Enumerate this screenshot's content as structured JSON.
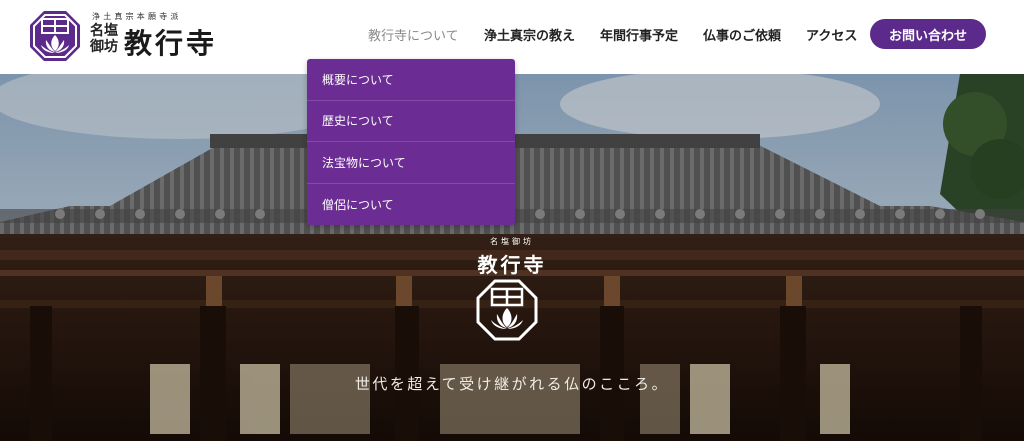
{
  "logo": {
    "sub_text": "浄土真宗本願寺派",
    "small_text": "名塩御坊",
    "main_text": "教行寺"
  },
  "nav": {
    "items": [
      {
        "label": "教行寺について"
      },
      {
        "label": "浄土真宗の教え"
      },
      {
        "label": "年間行事予定"
      },
      {
        "label": "仏事のご依頼"
      },
      {
        "label": "アクセス"
      }
    ],
    "contact_label": "お問い合わせ"
  },
  "dropdown": {
    "items": [
      {
        "label": "概要について"
      },
      {
        "label": "歴史について"
      },
      {
        "label": "法宝物について"
      },
      {
        "label": "僧侶について"
      }
    ]
  },
  "hero": {
    "small_text": "名塩御坊",
    "title": "教行寺",
    "tagline": "世代を超えて受け継がれる仏のこころ。"
  },
  "colors": {
    "brand_purple": "#5b2a8a",
    "dropdown_bg": "#6b2d93",
    "header_bg": "#ffffff"
  },
  "icons": {
    "logo": "temple-lotus-crest-icon",
    "hero_logo": "temple-lotus-crest-icon"
  }
}
